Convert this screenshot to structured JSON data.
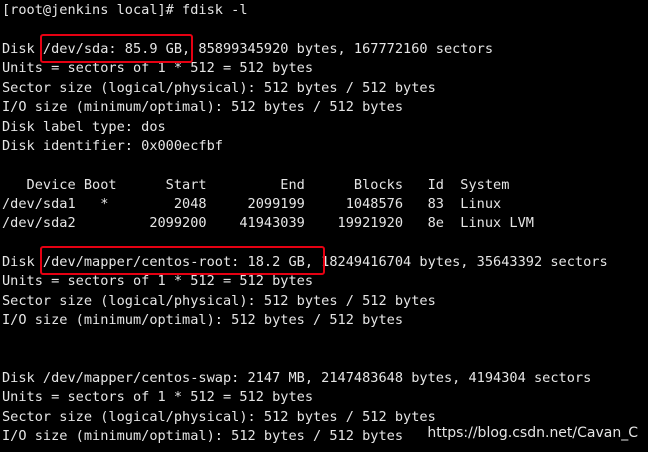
{
  "terminal": {
    "background": "#000000",
    "foreground": "#e6e6e6",
    "highlight_color": "#e60012",
    "lines": [
      "[root@jenkins local]# fdisk -l",
      "",
      "Disk /dev/sda: 85.9 GB, 85899345920 bytes, 167772160 sectors",
      "Units = sectors of 1 * 512 = 512 bytes",
      "Sector size (logical/physical): 512 bytes / 512 bytes",
      "I/O size (minimum/optimal): 512 bytes / 512 bytes",
      "Disk label type: dos",
      "Disk identifier: 0x000ecfbf",
      "",
      "   Device Boot      Start         End      Blocks   Id  System",
      "/dev/sda1   *        2048     2099199     1048576   83  Linux",
      "/dev/sda2         2099200    41943039    19921920   8e  Linux LVM",
      "",
      "Disk /dev/mapper/centos-root: 18.2 GB, 18249416704 bytes, 35643392 sectors",
      "Units = sectors of 1 * 512 = 512 bytes",
      "Sector size (logical/physical): 512 bytes / 512 bytes",
      "I/O size (minimum/optimal): 512 bytes / 512 bytes",
      "",
      "",
      "Disk /dev/mapper/centos-swap: 2147 MB, 2147483648 bytes, 4194304 sectors",
      "Units = sectors of 1 * 512 = 512 bytes",
      "Sector size (logical/physical): 512 bytes / 512 bytes",
      "I/O size (minimum/optimal): 512 bytes / 512 bytes"
    ]
  },
  "watermark": "https://blog.csdn.net/Cavan_C"
}
